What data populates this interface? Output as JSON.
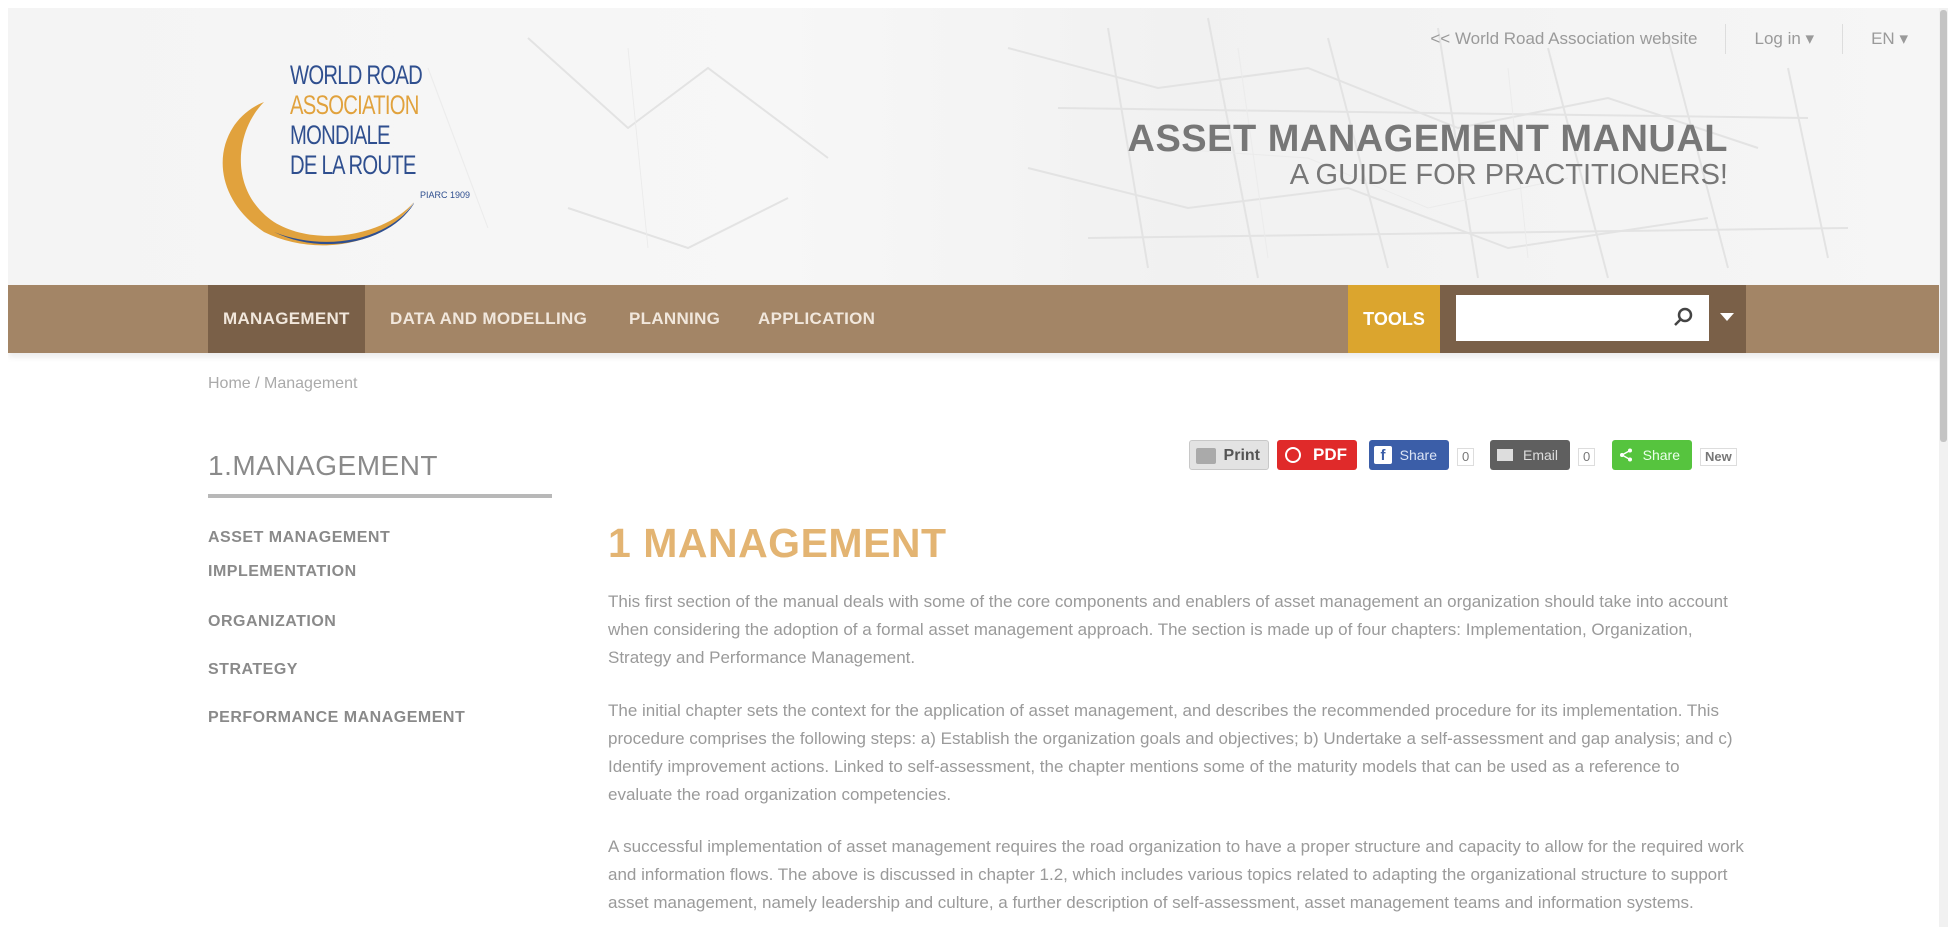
{
  "top_links": {
    "association_link": "<< World Road Association website",
    "login": "Log in",
    "language": "EN"
  },
  "logo": {
    "line1": "WORLD ROAD",
    "line2": "ASSOCIATION",
    "line3": "MONDIALE",
    "line4": "DE LA ROUTE",
    "small": "PIARC 1909"
  },
  "site_title": {
    "title": "ASSET MANAGEMENT MANUAL",
    "subtitle": "A GUIDE FOR PRACTITIONERS!"
  },
  "nav": {
    "items": [
      {
        "label": "MANAGEMENT"
      },
      {
        "label": "DATA AND MODELLING"
      },
      {
        "label": "PLANNING"
      },
      {
        "label": "APPLICATION"
      }
    ],
    "tools_label": "TOOLS",
    "search_placeholder": ""
  },
  "breadcrumb": "Home / Management",
  "sidebar": {
    "title": "1.MANAGEMENT",
    "items": [
      {
        "label": "ASSET MANAGEMENT IMPLEMENTATION"
      },
      {
        "label": "ORGANIZATION"
      },
      {
        "label": "STRATEGY"
      },
      {
        "label": "PERFORMANCE MANAGEMENT"
      }
    ]
  },
  "share": {
    "print": "Print",
    "pdf": "PDF",
    "facebook": "Share",
    "facebook_count": "0",
    "email": "Email",
    "email_count": "0",
    "share": "Share",
    "new": "New"
  },
  "content": {
    "title": "1 MANAGEMENT",
    "paragraphs": [
      "This first section of the manual deals with some of the core components and enablers of asset management an organization should take into account when considering the adoption of a formal asset management approach. The section is made up of four chapters: Implementation, Organization, Strategy and Performance Management.",
      "The initial chapter sets the context for the application of asset management, and describes the recommended procedure for its implementation. This procedure comprises the following steps: a) Establish the organization goals and objectives; b) Undertake a self-assessment and gap analysis; and c) Identify improvement actions. Linked to self-assessment, the chapter mentions some of the maturity models that can be used as a reference to evaluate the road organization competencies.",
      "A successful implementation of asset management requires the road organization to have a proper structure and capacity to allow for the required work and information flows. The above is discussed in chapter 1.2, which includes various topics related to adapting the organizational structure to support asset management, namely leadership and culture, a further description of self-assessment, asset management teams and information systems."
    ]
  },
  "colors": {
    "nav_bg": "#a38566",
    "nav_active": "#7a6048",
    "tools_bg": "#dba52e",
    "title_accent": "#e3b472",
    "pdf_red": "#e02a2a",
    "facebook_blue": "#3b5ea8",
    "share_green": "#56c43e"
  }
}
